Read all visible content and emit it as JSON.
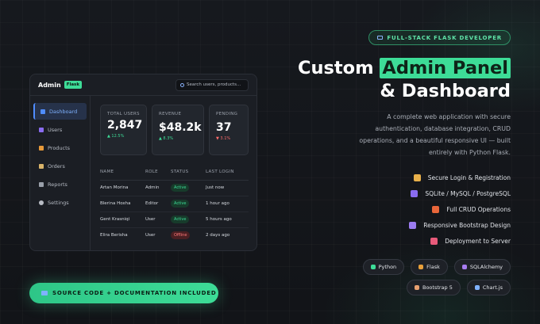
{
  "admin": {
    "brand": "Admin",
    "brand_tag": "Flask",
    "search_placeholder": "Search users, products...",
    "sidebar": [
      {
        "label": "Dashboard",
        "icon": "chart-icon",
        "color": "#4f8dff",
        "active": true
      },
      {
        "label": "Users",
        "icon": "users-icon",
        "color": "#8a6cf0",
        "active": false
      },
      {
        "label": "Products",
        "icon": "box-icon",
        "color": "#e89a3a",
        "active": false
      },
      {
        "label": "Orders",
        "icon": "clipboard-icon",
        "color": "#d9b46a",
        "active": false
      },
      {
        "label": "Reports",
        "icon": "report-icon",
        "color": "#9aa0aa",
        "active": false
      },
      {
        "label": "Settings",
        "icon": "gear-icon",
        "color": "#b8bcc4",
        "active": false
      }
    ],
    "stats": [
      {
        "label": "TOTAL USERS",
        "value": "2,847",
        "delta": "▲ 12.5%",
        "trend": "up"
      },
      {
        "label": "REVENUE",
        "value": "$48.2k",
        "delta": "▲ 8.3%",
        "trend": "up"
      },
      {
        "label": "PENDING",
        "value": "37",
        "delta": "▼ 3.1%",
        "trend": "down"
      }
    ],
    "table": {
      "headers": [
        "NAME",
        "ROLE",
        "STATUS",
        "LAST LOGIN"
      ],
      "rows": [
        {
          "name": "Artan Morina",
          "role": "Admin",
          "status": "Active",
          "last": "Just now"
        },
        {
          "name": "Blerina Hoxha",
          "role": "Editor",
          "status": "Active",
          "last": "1 hour ago"
        },
        {
          "name": "Gent Krasniqi",
          "role": "User",
          "status": "Active",
          "last": "5 hours ago"
        },
        {
          "name": "Elira Berisha",
          "role": "User",
          "status": "Offline",
          "last": "2 days ago"
        }
      ]
    }
  },
  "hero": {
    "badge": "FULL-STACK FLASK DEVELOPER",
    "title_pre": "Custom ",
    "title_highlight": "Admin Panel",
    "title_line2": "& Dashboard",
    "description": "A complete web application with secure authentication, database integration, CRUD operations, and a beautiful responsive UI — built entirely with Python Flask.",
    "features": [
      {
        "label": "Secure Login & Registration",
        "icon": "lock-icon",
        "color": "#e8b04a"
      },
      {
        "label": "SQLite / MySQL / PostgreSQL",
        "icon": "database-icon",
        "color": "#8a6cf0"
      },
      {
        "label": "Full CRUD Operations",
        "icon": "pencil-icon",
        "color": "#e8663a"
      },
      {
        "label": "Responsive Bootstrap Design",
        "icon": "phone-icon",
        "color": "#9b7cf0"
      },
      {
        "label": "Deployment to Server",
        "icon": "rocket-icon",
        "color": "#e85a7a"
      }
    ],
    "tech": [
      {
        "label": "Python",
        "icon": "python-icon",
        "color": "#3ddc97"
      },
      {
        "label": "Flask",
        "icon": "flask-icon",
        "color": "#e8a03a"
      },
      {
        "label": "SQLAlchemy",
        "icon": "database-icon",
        "color": "#a77cf0"
      },
      {
        "label": "Bootstrap 5",
        "icon": "palette-icon",
        "color": "#e8a070"
      },
      {
        "label": "Chart.js",
        "icon": "chart-icon",
        "color": "#7fb2ff"
      }
    ],
    "cta": "SOURCE CODE + DOCUMENTATION INCLUDED"
  }
}
